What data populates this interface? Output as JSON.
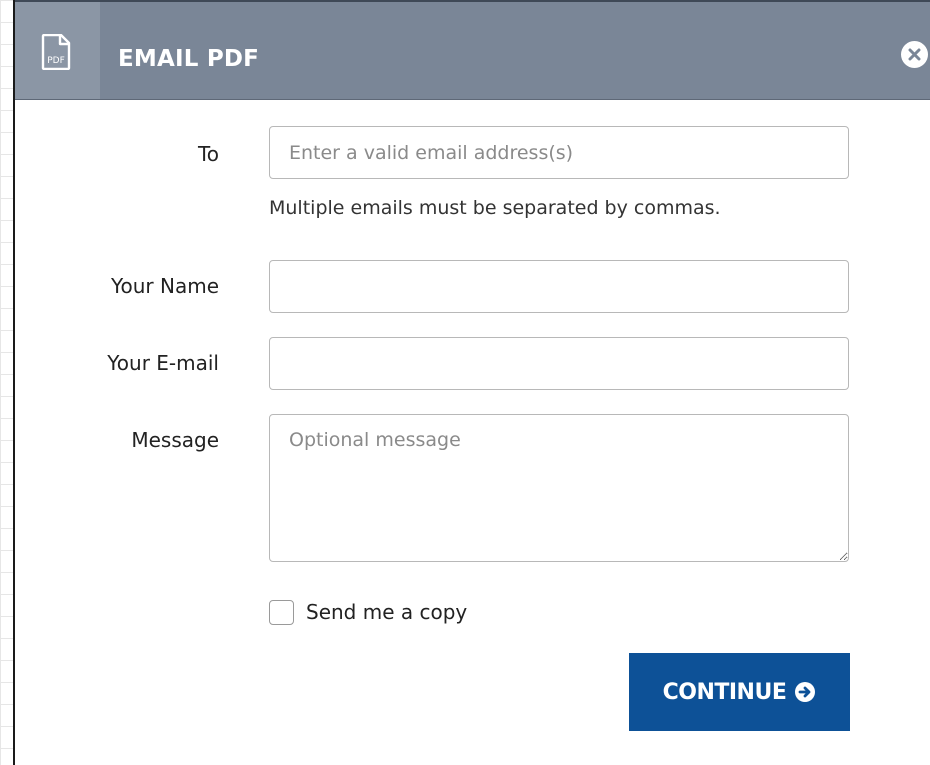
{
  "header": {
    "title": "EMAIL PDF",
    "icon_text": "PDF",
    "icon": "pdf-file-icon",
    "close_icon": "close-icon"
  },
  "form": {
    "to": {
      "label": "To",
      "placeholder": "Enter a valid email address(s)",
      "value": "",
      "hint": "Multiple emails must be separated by commas."
    },
    "your_name": {
      "label": "Your Name",
      "value": ""
    },
    "your_email": {
      "label": "Your E-mail",
      "value": ""
    },
    "message": {
      "label": "Message",
      "placeholder": "Optional message",
      "value": ""
    },
    "send_copy": {
      "label": "Send me a copy",
      "checked": false
    }
  },
  "actions": {
    "continue_label": "CONTINUE",
    "continue_icon": "arrow-circle-right-icon"
  },
  "colors": {
    "header_bg": "#7a8697",
    "header_icon_bg": "#8b96a5",
    "primary_button": "#0d5197",
    "field_border": "#b8b8b8"
  }
}
